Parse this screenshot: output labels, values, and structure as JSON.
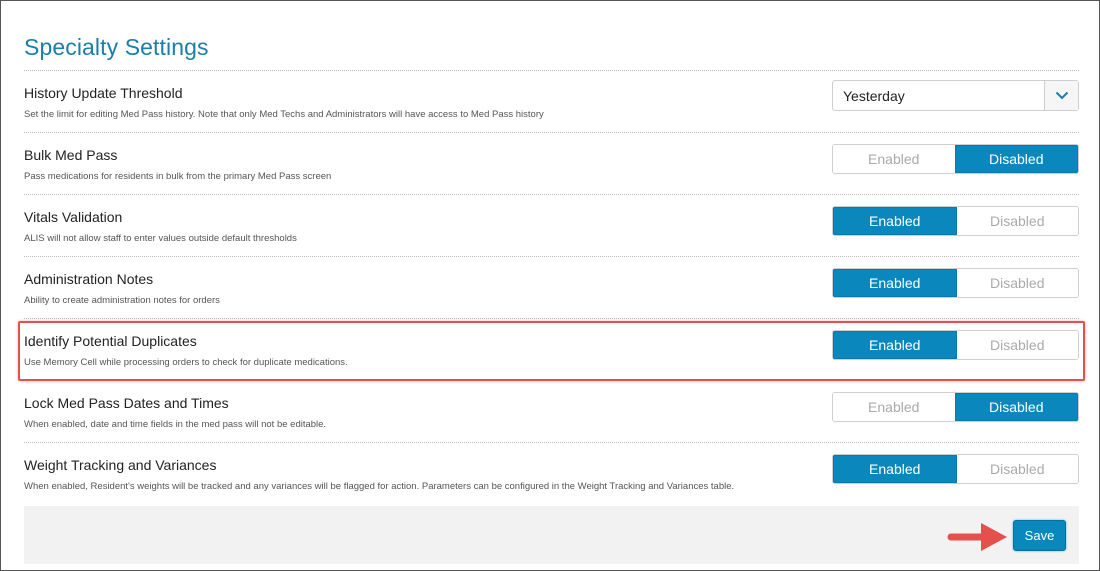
{
  "page": {
    "title": "Specialty Settings"
  },
  "settings": [
    {
      "title": "History Update Threshold",
      "desc": "Set the limit for editing Med Pass history. Note that only Med Techs and Administrators will have access to Med Pass history",
      "control": "select",
      "value": "Yesterday"
    },
    {
      "title": "Bulk Med Pass",
      "desc": "Pass medications for residents in bulk from the primary Med Pass screen",
      "control": "toggle",
      "enabled_label": "Enabled",
      "disabled_label": "Disabled",
      "selected": "Disabled"
    },
    {
      "title": "Vitals Validation",
      "desc": "ALIS will not allow staff to enter values outside default thresholds",
      "control": "toggle",
      "enabled_label": "Enabled",
      "disabled_label": "Disabled",
      "selected": "Enabled"
    },
    {
      "title": "Administration Notes",
      "desc": "Ability to create administration notes for orders",
      "control": "toggle",
      "enabled_label": "Enabled",
      "disabled_label": "Disabled",
      "selected": "Enabled"
    },
    {
      "title": "Identify Potential Duplicates",
      "desc": "Use Memory Cell while processing orders to check for duplicate medications.",
      "control": "toggle",
      "enabled_label": "Enabled",
      "disabled_label": "Disabled",
      "selected": "Enabled"
    },
    {
      "title": "Lock Med Pass Dates and Times",
      "desc": "When enabled, date and time fields in the med pass will not be editable.",
      "control": "toggle",
      "enabled_label": "Enabled",
      "disabled_label": "Disabled",
      "selected": "Disabled"
    },
    {
      "title": "Weight Tracking and Variances",
      "desc": "When enabled, Resident's weights will be tracked and any variances will be flagged for action. Parameters can be configured in the Weight Tracking and Variances table.",
      "control": "toggle",
      "enabled_label": "Enabled",
      "disabled_label": "Disabled",
      "selected": "Enabled"
    }
  ],
  "footer": {
    "save_label": "Save"
  },
  "colors": {
    "accent": "#0a88be",
    "title": "#1a7fa8",
    "highlight": "#e5504d"
  },
  "icons": {
    "select": "chevron-down-icon",
    "callout": "arrow-right-icon"
  }
}
